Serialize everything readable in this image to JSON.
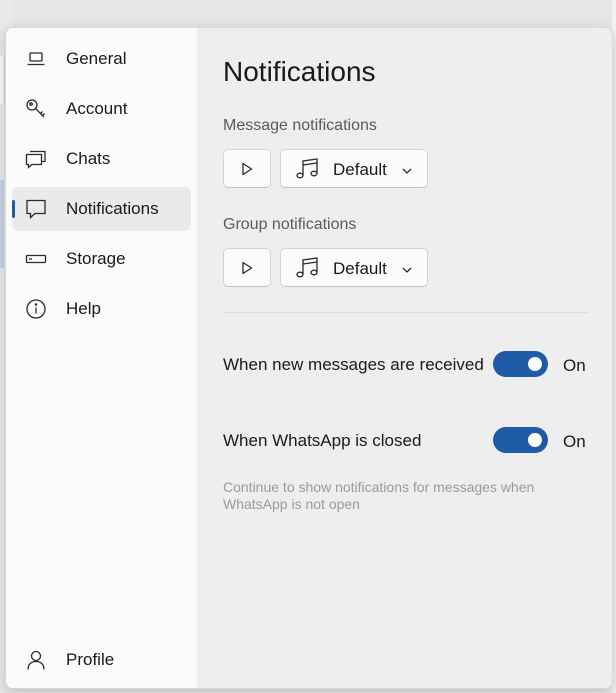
{
  "sidebar": {
    "items": [
      {
        "label": "General",
        "icon": "laptop-icon"
      },
      {
        "label": "Account",
        "icon": "key-icon"
      },
      {
        "label": "Chats",
        "icon": "chat-icon"
      },
      {
        "label": "Notifications",
        "icon": "notification-icon",
        "selected": true
      },
      {
        "label": "Storage",
        "icon": "storage-icon"
      },
      {
        "label": "Help",
        "icon": "info-icon"
      }
    ],
    "profile": {
      "label": "Profile",
      "icon": "person-icon"
    }
  },
  "content": {
    "title": "Notifications",
    "message_notifications": {
      "label": "Message notifications",
      "sound_value": "Default"
    },
    "group_notifications": {
      "label": "Group notifications",
      "sound_value": "Default"
    },
    "toggles": [
      {
        "label": "When new messages are received",
        "state": "On",
        "on": true
      },
      {
        "label": "When WhatsApp is closed",
        "state": "On",
        "on": true
      }
    ],
    "closed_help": "Continue to show notifications for messages when WhatsApp is not open"
  },
  "colors": {
    "accent": "#1f5aa6",
    "sidebar_bg": "#fbfbfb",
    "content_bg": "#eeeeee"
  }
}
